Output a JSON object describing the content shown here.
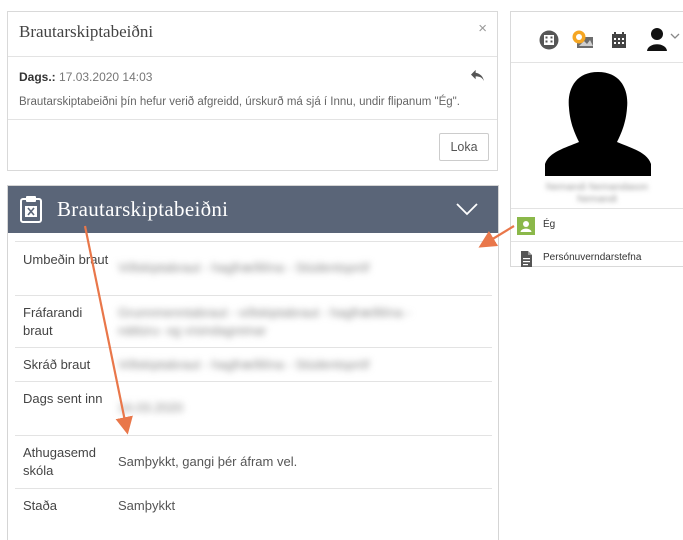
{
  "message": {
    "title": "Brautarskiptabeiðni",
    "close_symbol": "×",
    "date_label": "Dags.:",
    "date_value": "17.03.2020 14:03",
    "body": "Brautarskiptabeiðni þín hefur verið afgreidd, úrskurð má sjá í Innu, undir flipanum \"Ég\".",
    "close_button": "Loka"
  },
  "request": {
    "title": "Brautarskiptabeiðni",
    "rows": [
      {
        "label": "Umbeðin braut",
        "value": "Viðskiptabraut - hagfræðilína - Stúdentspróf",
        "blurred": true
      },
      {
        "label": "Fráfarandi braut",
        "value": "Grunnmenntabraut - viðskiptabraut - hagfræðilína - náttúru- og vísindagreinar",
        "blurred": true
      },
      {
        "label": "Skráð braut",
        "value": "Viðskiptabraut - hagfræðilína - Stúdentspróf",
        "blurred": true
      },
      {
        "label": "Dags sent inn",
        "value": "16.03.2020",
        "blurred": true
      },
      {
        "label": "Athugasemd skóla",
        "value": "Samþykkt, gangi þér áfram vel.",
        "blurred": false
      },
      {
        "label": "Staða",
        "value": "Samþykkt",
        "blurred": false
      }
    ]
  },
  "sidebar": {
    "icons": [
      "school-icon",
      "notification-badge-icon",
      "calendar-icon",
      "user-menu-icon"
    ],
    "user_name": "Nemandi Nemandason",
    "user_sub": "Nemandi",
    "items": [
      {
        "label": "Ég",
        "icon": "person-icon"
      },
      {
        "label": "Persónuverndarstefna",
        "icon": "document-icon"
      }
    ]
  },
  "colors": {
    "header_bg": "#5a6578",
    "annotation_arrow": "#e9774a",
    "active_item": "#8bb84a"
  }
}
